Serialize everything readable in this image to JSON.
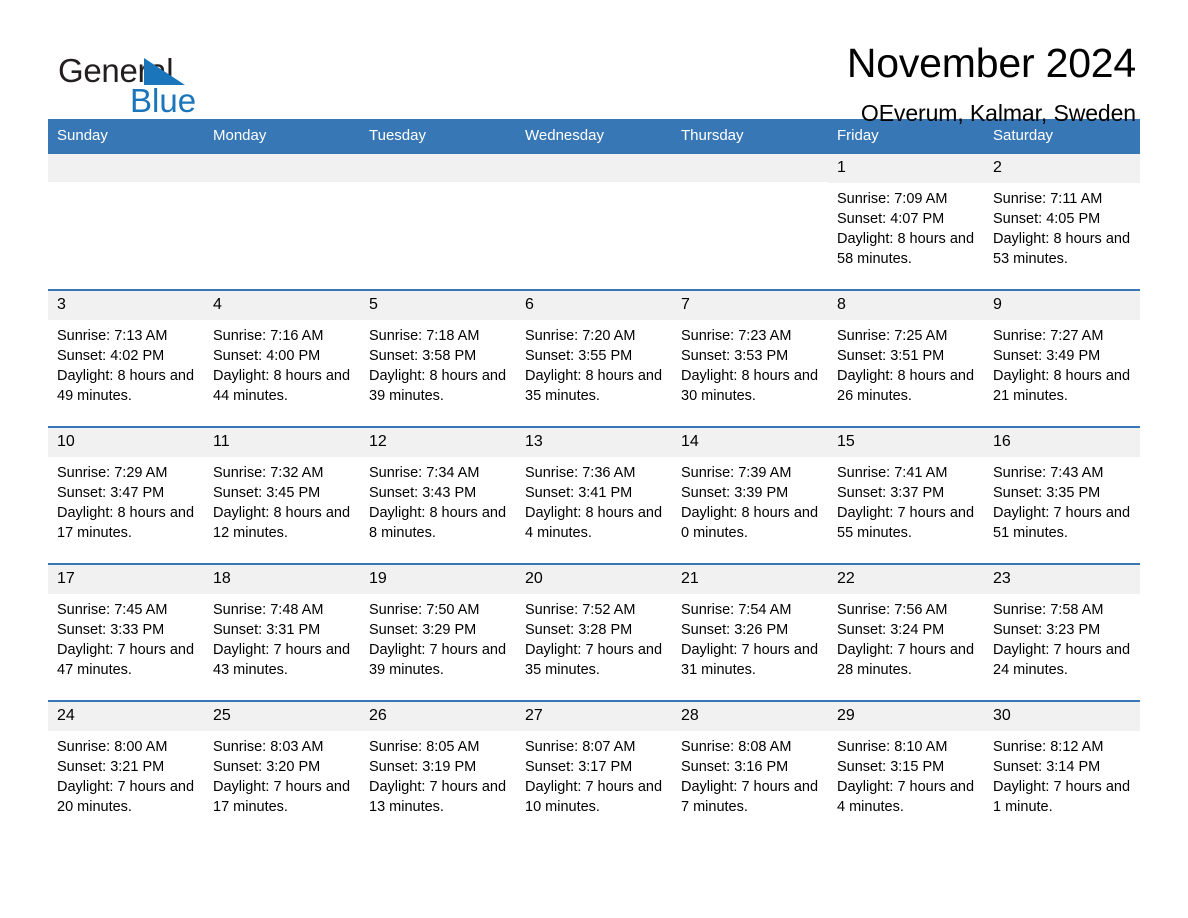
{
  "brand": {
    "name_part1": "General",
    "name_part2": "Blue",
    "accent_color": "#1b75bb"
  },
  "header": {
    "title": "November 2024",
    "location": "OEverum, Kalmar, Sweden"
  },
  "theme": {
    "header_row_bg": "#3877b5",
    "day_number_bg": "#f1f1f1",
    "text_color": "#010101"
  },
  "weekdays": [
    "Sunday",
    "Monday",
    "Tuesday",
    "Wednesday",
    "Thursday",
    "Friday",
    "Saturday"
  ],
  "weeks": [
    [
      {
        "day": "",
        "empty": true
      },
      {
        "day": "",
        "empty": true
      },
      {
        "day": "",
        "empty": true
      },
      {
        "day": "",
        "empty": true
      },
      {
        "day": "",
        "empty": true
      },
      {
        "day": "1",
        "sunrise": "Sunrise: 7:09 AM",
        "sunset": "Sunset: 4:07 PM",
        "daylight": "Daylight: 8 hours and 58 minutes."
      },
      {
        "day": "2",
        "sunrise": "Sunrise: 7:11 AM",
        "sunset": "Sunset: 4:05 PM",
        "daylight": "Daylight: 8 hours and 53 minutes."
      }
    ],
    [
      {
        "day": "3",
        "sunrise": "Sunrise: 7:13 AM",
        "sunset": "Sunset: 4:02 PM",
        "daylight": "Daylight: 8 hours and 49 minutes."
      },
      {
        "day": "4",
        "sunrise": "Sunrise: 7:16 AM",
        "sunset": "Sunset: 4:00 PM",
        "daylight": "Daylight: 8 hours and 44 minutes."
      },
      {
        "day": "5",
        "sunrise": "Sunrise: 7:18 AM",
        "sunset": "Sunset: 3:58 PM",
        "daylight": "Daylight: 8 hours and 39 minutes."
      },
      {
        "day": "6",
        "sunrise": "Sunrise: 7:20 AM",
        "sunset": "Sunset: 3:55 PM",
        "daylight": "Daylight: 8 hours and 35 minutes."
      },
      {
        "day": "7",
        "sunrise": "Sunrise: 7:23 AM",
        "sunset": "Sunset: 3:53 PM",
        "daylight": "Daylight: 8 hours and 30 minutes."
      },
      {
        "day": "8",
        "sunrise": "Sunrise: 7:25 AM",
        "sunset": "Sunset: 3:51 PM",
        "daylight": "Daylight: 8 hours and 26 minutes."
      },
      {
        "day": "9",
        "sunrise": "Sunrise: 7:27 AM",
        "sunset": "Sunset: 3:49 PM",
        "daylight": "Daylight: 8 hours and 21 minutes."
      }
    ],
    [
      {
        "day": "10",
        "sunrise": "Sunrise: 7:29 AM",
        "sunset": "Sunset: 3:47 PM",
        "daylight": "Daylight: 8 hours and 17 minutes."
      },
      {
        "day": "11",
        "sunrise": "Sunrise: 7:32 AM",
        "sunset": "Sunset: 3:45 PM",
        "daylight": "Daylight: 8 hours and 12 minutes."
      },
      {
        "day": "12",
        "sunrise": "Sunrise: 7:34 AM",
        "sunset": "Sunset: 3:43 PM",
        "daylight": "Daylight: 8 hours and 8 minutes."
      },
      {
        "day": "13",
        "sunrise": "Sunrise: 7:36 AM",
        "sunset": "Sunset: 3:41 PM",
        "daylight": "Daylight: 8 hours and 4 minutes."
      },
      {
        "day": "14",
        "sunrise": "Sunrise: 7:39 AM",
        "sunset": "Sunset: 3:39 PM",
        "daylight": "Daylight: 8 hours and 0 minutes."
      },
      {
        "day": "15",
        "sunrise": "Sunrise: 7:41 AM",
        "sunset": "Sunset: 3:37 PM",
        "daylight": "Daylight: 7 hours and 55 minutes."
      },
      {
        "day": "16",
        "sunrise": "Sunrise: 7:43 AM",
        "sunset": "Sunset: 3:35 PM",
        "daylight": "Daylight: 7 hours and 51 minutes."
      }
    ],
    [
      {
        "day": "17",
        "sunrise": "Sunrise: 7:45 AM",
        "sunset": "Sunset: 3:33 PM",
        "daylight": "Daylight: 7 hours and 47 minutes."
      },
      {
        "day": "18",
        "sunrise": "Sunrise: 7:48 AM",
        "sunset": "Sunset: 3:31 PM",
        "daylight": "Daylight: 7 hours and 43 minutes."
      },
      {
        "day": "19",
        "sunrise": "Sunrise: 7:50 AM",
        "sunset": "Sunset: 3:29 PM",
        "daylight": "Daylight: 7 hours and 39 minutes."
      },
      {
        "day": "20",
        "sunrise": "Sunrise: 7:52 AM",
        "sunset": "Sunset: 3:28 PM",
        "daylight": "Daylight: 7 hours and 35 minutes."
      },
      {
        "day": "21",
        "sunrise": "Sunrise: 7:54 AM",
        "sunset": "Sunset: 3:26 PM",
        "daylight": "Daylight: 7 hours and 31 minutes."
      },
      {
        "day": "22",
        "sunrise": "Sunrise: 7:56 AM",
        "sunset": "Sunset: 3:24 PM",
        "daylight": "Daylight: 7 hours and 28 minutes."
      },
      {
        "day": "23",
        "sunrise": "Sunrise: 7:58 AM",
        "sunset": "Sunset: 3:23 PM",
        "daylight": "Daylight: 7 hours and 24 minutes."
      }
    ],
    [
      {
        "day": "24",
        "sunrise": "Sunrise: 8:00 AM",
        "sunset": "Sunset: 3:21 PM",
        "daylight": "Daylight: 7 hours and 20 minutes."
      },
      {
        "day": "25",
        "sunrise": "Sunrise: 8:03 AM",
        "sunset": "Sunset: 3:20 PM",
        "daylight": "Daylight: 7 hours and 17 minutes."
      },
      {
        "day": "26",
        "sunrise": "Sunrise: 8:05 AM",
        "sunset": "Sunset: 3:19 PM",
        "daylight": "Daylight: 7 hours and 13 minutes."
      },
      {
        "day": "27",
        "sunrise": "Sunrise: 8:07 AM",
        "sunset": "Sunset: 3:17 PM",
        "daylight": "Daylight: 7 hours and 10 minutes."
      },
      {
        "day": "28",
        "sunrise": "Sunrise: 8:08 AM",
        "sunset": "Sunset: 3:16 PM",
        "daylight": "Daylight: 7 hours and 7 minutes."
      },
      {
        "day": "29",
        "sunrise": "Sunrise: 8:10 AM",
        "sunset": "Sunset: 3:15 PM",
        "daylight": "Daylight: 7 hours and 4 minutes."
      },
      {
        "day": "30",
        "sunrise": "Sunrise: 8:12 AM",
        "sunset": "Sunset: 3:14 PM",
        "daylight": "Daylight: 7 hours and 1 minute."
      }
    ]
  ]
}
